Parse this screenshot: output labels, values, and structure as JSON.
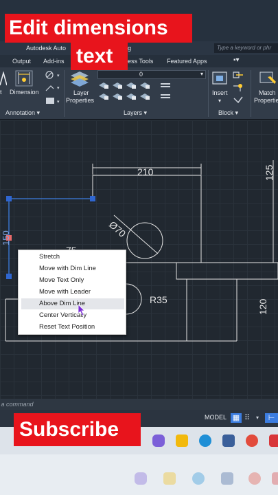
{
  "window": {
    "app_title": "Autodesk Auto",
    "file_name": ".dwg",
    "search_placeholder": "Type a keyword or phr"
  },
  "tabs": [
    "Output",
    "Add-ins",
    "ress Tools",
    "Featured Apps"
  ],
  "ribbon": {
    "dimension_label": "Dimension",
    "annotation_label": "Annotation",
    "layer_properties_label_1": "Layer",
    "layer_properties_label_2": "Properties",
    "layer_value": "0",
    "layers_label": "Layers",
    "insert_label": "Insert",
    "block_label": "Block",
    "match_label_1": "Match",
    "match_label_2": "Propertie"
  },
  "drawing": {
    "dim_210": "210",
    "dim_125": "125",
    "dim_diameter": "Ø70",
    "dim_75": "75",
    "dim_r35": "R35",
    "dim_120": "120",
    "dim_150": "150"
  },
  "context_menu": {
    "items": [
      "Stretch",
      "Move with Dim Line",
      "Move Text Only",
      "Move with Leader",
      "Above Dim Line",
      "Center Vertically",
      "Reset Text Position"
    ],
    "hovered_index": 4
  },
  "command_line": {
    "placeholder": "e a command"
  },
  "status": {
    "model_label": "MODEL"
  },
  "overlays": {
    "title_line_1": "Edit dimensions",
    "title_line_2": "text",
    "subscribe": "Subscribe"
  },
  "colors": {
    "accent_red": "#e8141c",
    "selection_blue": "#3c7de0",
    "drawing_line": "#e6e6e6"
  }
}
